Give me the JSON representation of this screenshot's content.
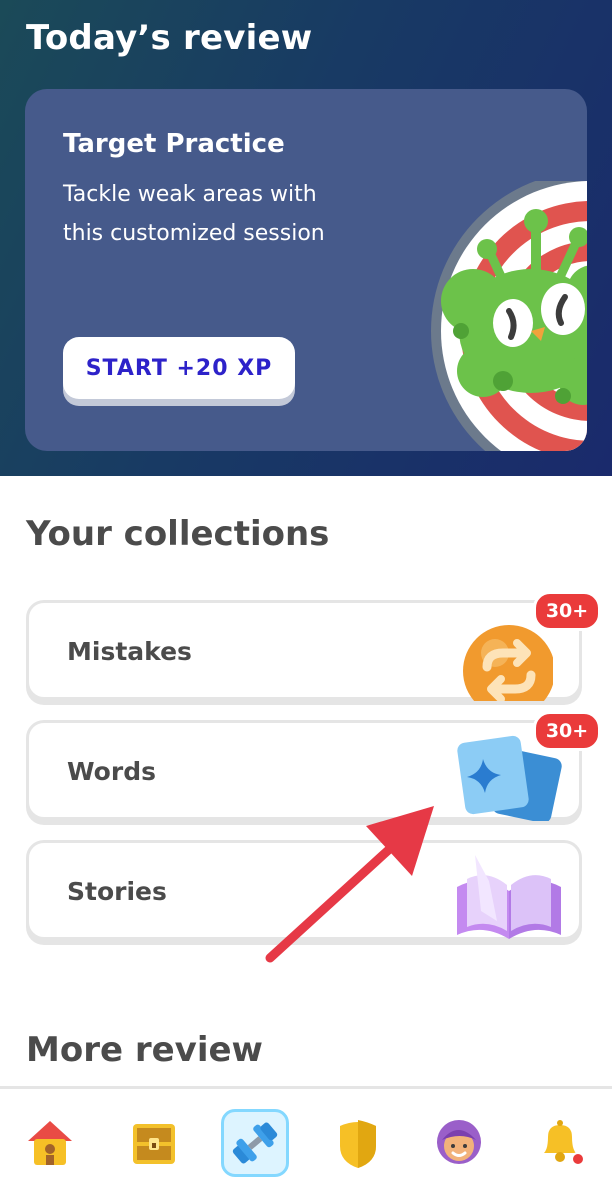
{
  "review": {
    "title": "Today’s review",
    "card": {
      "title": "Target Practice",
      "description": "Tackle weak areas with this customized session",
      "button": "START +20 XP"
    }
  },
  "collections": {
    "title": "Your collections",
    "items": [
      {
        "label": "Mistakes",
        "badge": "30+",
        "icon": "refresh-icon"
      },
      {
        "label": "Words",
        "badge": "30+",
        "icon": "flashcards-icon"
      },
      {
        "label": "Stories",
        "icon": "open-book-icon"
      }
    ]
  },
  "more_review": {
    "title": "More review"
  },
  "nav": {
    "items": [
      "home-icon",
      "chest-icon",
      "dumbbell-icon",
      "shield-icon",
      "avatar-icon",
      "bell-icon"
    ],
    "active": "dumbbell-icon"
  },
  "colors": {
    "brand_blue": "#2d22c9",
    "badge_red": "#ea3b3b",
    "card_bg": "#465a8b",
    "active_nav": "#84d8ff"
  }
}
